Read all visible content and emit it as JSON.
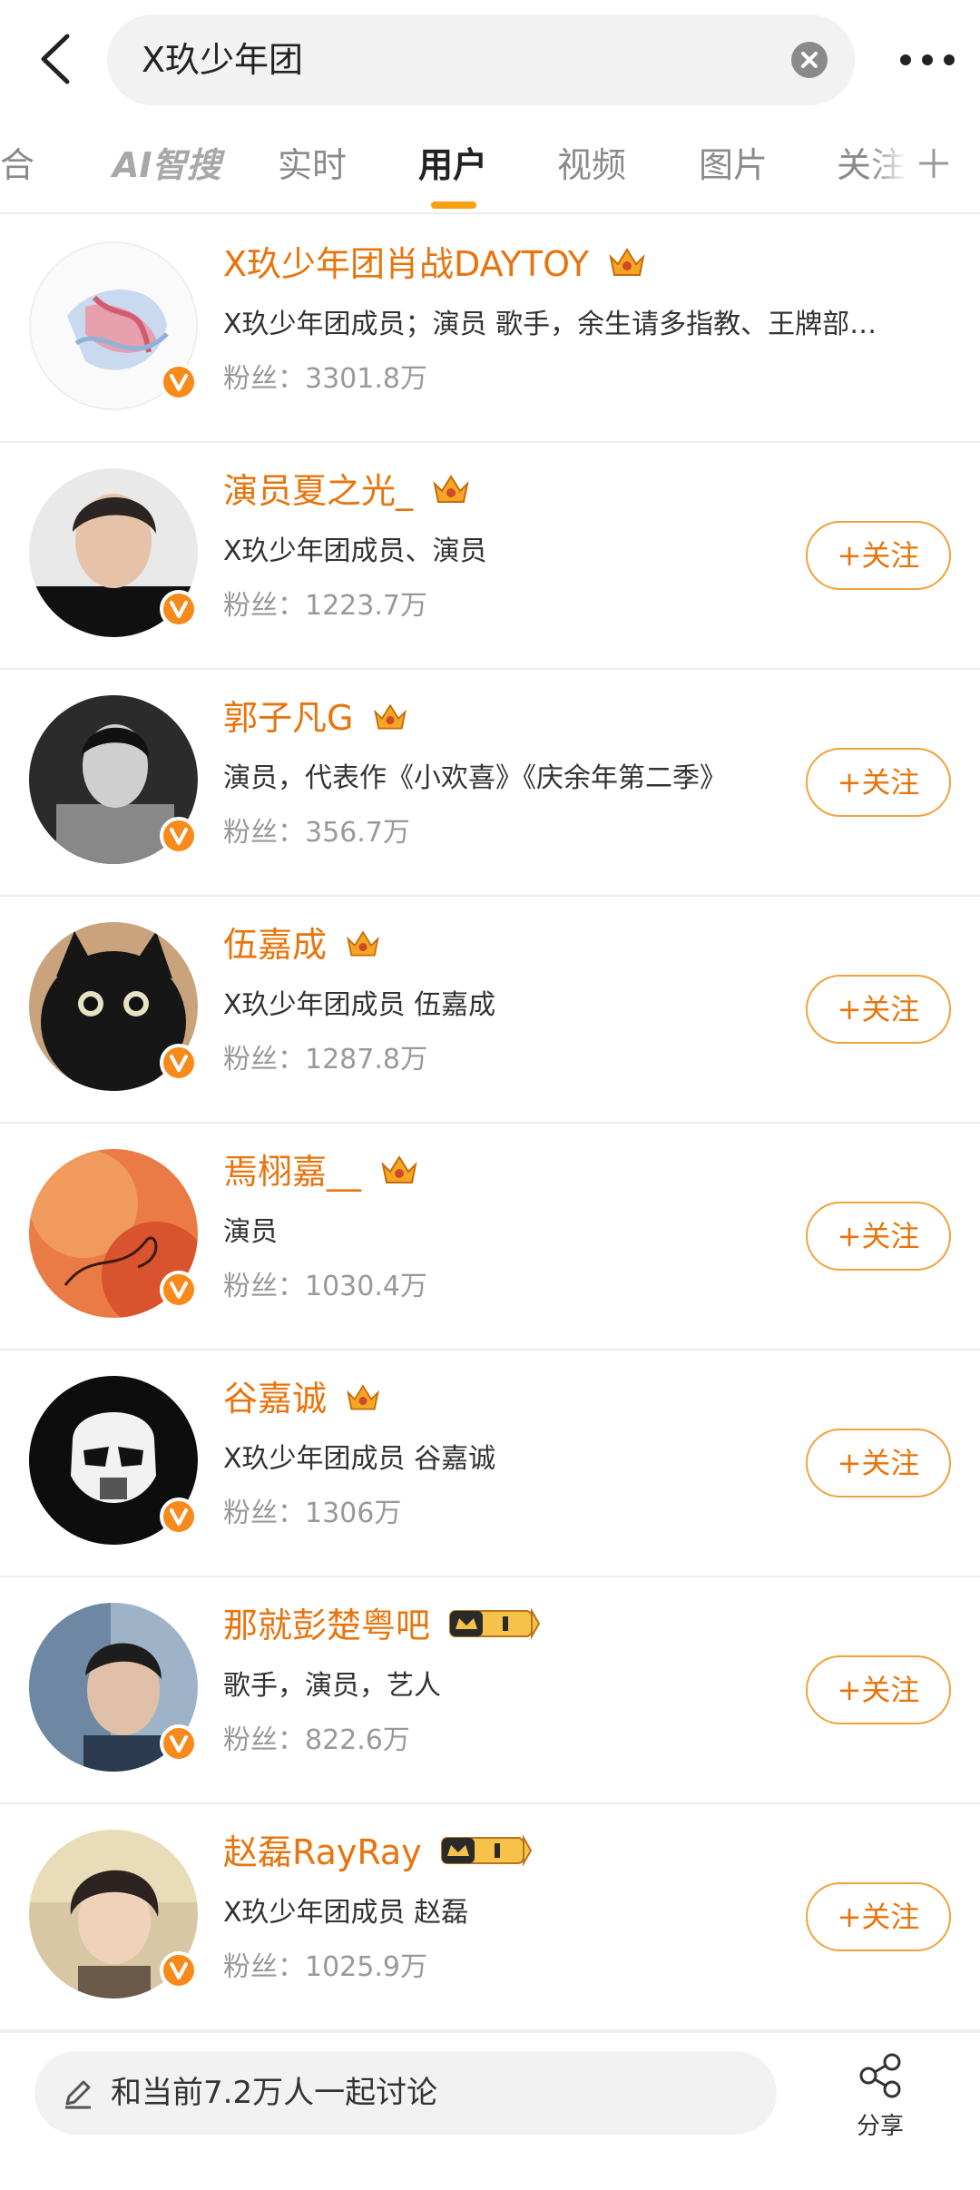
{
  "search": {
    "query": "X玖少年团"
  },
  "tabs": [
    {
      "label": "综合"
    },
    {
      "label": "AI智搜"
    },
    {
      "label": "实时"
    },
    {
      "label": "用户"
    },
    {
      "label": "视频"
    },
    {
      "label": "图片"
    },
    {
      "label": "关注"
    }
  ],
  "users": [
    {
      "name": "X玖少年团肖战DAYTOY",
      "desc": "X玖少年团成员；演员 歌手，余生请多指教、王牌部…",
      "fans": "粉丝：3301.8万",
      "follow": ""
    },
    {
      "name": "演员夏之光_",
      "desc": "X玖少年团成员、演员",
      "fans": "粉丝：1223.7万",
      "follow": "+关注"
    },
    {
      "name": "郭子凡G",
      "desc": "演员，代表作《小欢喜》《庆余年第二季》",
      "fans": "粉丝：356.7万",
      "follow": "+关注"
    },
    {
      "name": "伍嘉成",
      "desc": "X玖少年团成员  伍嘉成",
      "fans": "粉丝：1287.8万",
      "follow": "+关注"
    },
    {
      "name": "焉栩嘉__",
      "desc": "演员",
      "fans": "粉丝：1030.4万",
      "follow": "+关注"
    },
    {
      "name": "谷嘉诚",
      "desc": "X玖少年团成员  谷嘉诚",
      "fans": "粉丝：1306万",
      "follow": "+关注"
    },
    {
      "name": "那就彭楚粤吧",
      "desc": "歌手，演员，艺人",
      "fans": "粉丝：822.6万",
      "follow": "+关注"
    },
    {
      "name": "赵磊RayRay",
      "desc": "X玖少年团成员 赵磊",
      "fans": "粉丝：1025.9万",
      "follow": "+关注"
    }
  ],
  "bottom": {
    "discuss": "和当前7.2万人一起讨论",
    "share": "分享"
  },
  "colors": {
    "accent": "#e8740c",
    "tab_indicator": "#f7a012",
    "badge": "#f78a1a"
  }
}
